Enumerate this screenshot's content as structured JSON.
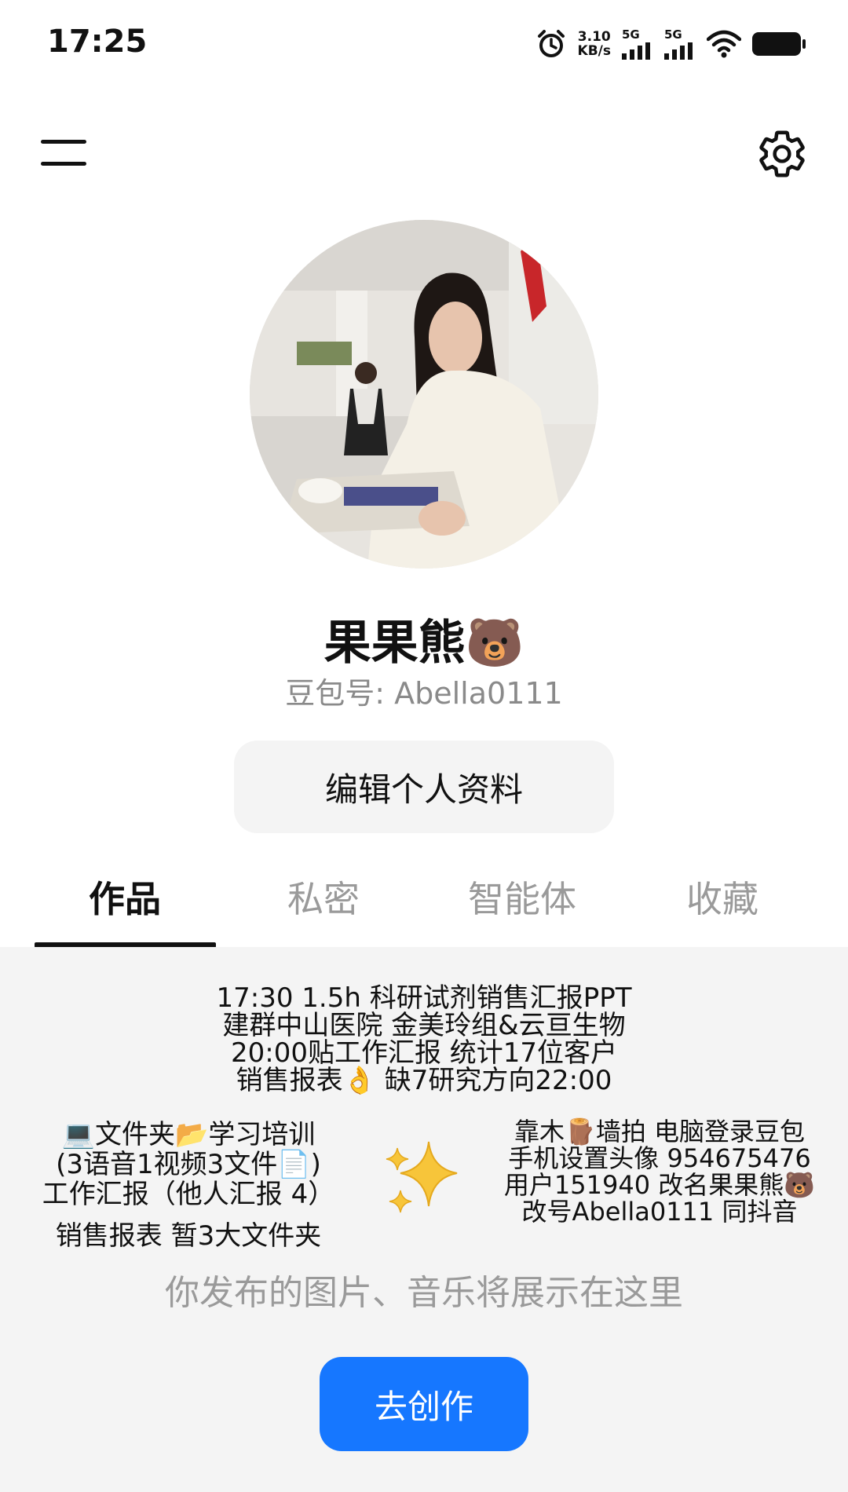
{
  "status_bar": {
    "time": "17:25",
    "net_speed_value": "3.10",
    "net_speed_unit": "KB/s",
    "signal1_label": "5G",
    "signal2_label": "5G",
    "icons": [
      "alarm-icon",
      "signal-icon",
      "signal-icon",
      "wifi-icon",
      "battery-icon"
    ]
  },
  "header": {
    "menu_icon": "menu-icon",
    "settings_icon": "gear-icon"
  },
  "profile": {
    "name": "果果熊🐻",
    "id_text": "豆包号: Abella0111",
    "edit_button": "编辑个人资料"
  },
  "tabs": [
    {
      "label": "作品",
      "active": true
    },
    {
      "label": "私密",
      "active": false
    },
    {
      "label": "智能体",
      "active": false
    },
    {
      "label": "收藏",
      "active": false
    }
  ],
  "content": {
    "note_top": "17:30 1.5h 科研试剂销售汇报PPT\n建群中山医院 金美玲组&云亘生物\n20:00贴工作汇报 统计17位客户\n销售报表👌 缺7研究方向22:00",
    "note_left": "💻文件夹📂学习培训\n(3语音1视频3文件📄)\n工作汇报（他人汇报 4）",
    "note_left2": "销售报表 暂3大文件夹",
    "note_right": "靠木🪵墙拍 电脑登录豆包\n手机设置头像 954675476\n用户151940 改名果果熊🐻\n改号Abella0111 同抖音",
    "sparkle_icon": "sparkles-icon",
    "placeholder": "你发布的图片、音乐将展示在这里",
    "create_button": "去创作"
  },
  "colors": {
    "accent": "#1677ff",
    "tab_inactive": "#9a9a9a",
    "content_bg": "#f4f4f4"
  }
}
